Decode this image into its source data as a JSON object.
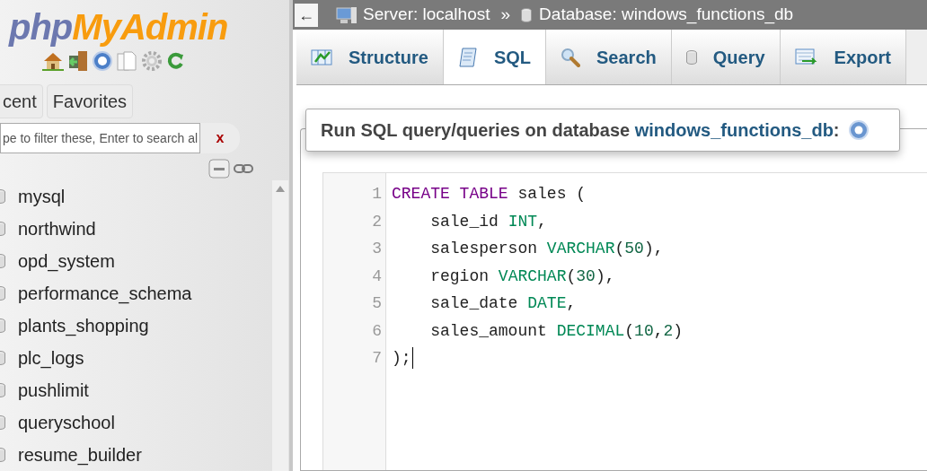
{
  "logo": {
    "part1": "php",
    "part2": "MyAdmin"
  },
  "nav_tabs": [
    {
      "label": "cent"
    },
    {
      "label": "Favorites"
    }
  ],
  "filter": {
    "placeholder": "pe to filter these, Enter to search al",
    "clear": "x"
  },
  "databases": [
    "mysql",
    "northwind",
    "opd_system",
    "performance_schema",
    "plants_shopping",
    "plc_logs",
    "pushlimit",
    "queryschool",
    "resume_builder"
  ],
  "breadcrumb": {
    "back": "←",
    "server": "Server: localhost",
    "separator": "»",
    "database": "Database: windows_functions_db"
  },
  "tabs": [
    {
      "label": "Structure",
      "kind": "structure",
      "selected": false
    },
    {
      "label": "SQL",
      "kind": "sql",
      "selected": true
    },
    {
      "label": "Search",
      "kind": "search",
      "selected": false
    },
    {
      "label": "Query",
      "kind": "query",
      "selected": false
    },
    {
      "label": "Export",
      "kind": "export",
      "selected": false
    }
  ],
  "heading": {
    "prefix": "Run SQL query/queries on database",
    "link": "windows_functions_db",
    "suffix": ":"
  },
  "editor": {
    "lines": [
      {
        "number": "1",
        "tokens": [
          {
            "kind": "keyword",
            "text": "CREATE TABLE"
          },
          {
            "kind": "plain",
            "text": " sales ("
          }
        ]
      },
      {
        "number": "2",
        "tokens": [
          {
            "kind": "plain",
            "text": "    sale_id "
          },
          {
            "kind": "type",
            "text": "INT"
          },
          {
            "kind": "plain",
            "text": ","
          }
        ]
      },
      {
        "number": "3",
        "tokens": [
          {
            "kind": "plain",
            "text": "    salesperson "
          },
          {
            "kind": "type",
            "text": "VARCHAR"
          },
          {
            "kind": "plain",
            "text": "("
          },
          {
            "kind": "number",
            "text": "50"
          },
          {
            "kind": "plain",
            "text": "),"
          }
        ]
      },
      {
        "number": "4",
        "tokens": [
          {
            "kind": "plain",
            "text": "    region "
          },
          {
            "kind": "type",
            "text": "VARCHAR"
          },
          {
            "kind": "plain",
            "text": "("
          },
          {
            "kind": "number",
            "text": "30"
          },
          {
            "kind": "plain",
            "text": "),"
          }
        ]
      },
      {
        "number": "5",
        "tokens": [
          {
            "kind": "plain",
            "text": "    sale_date "
          },
          {
            "kind": "type",
            "text": "DATE"
          },
          {
            "kind": "plain",
            "text": ","
          }
        ]
      },
      {
        "number": "6",
        "tokens": [
          {
            "kind": "plain",
            "text": "    sales_amount "
          },
          {
            "kind": "type",
            "text": "DECIMAL"
          },
          {
            "kind": "plain",
            "text": "("
          },
          {
            "kind": "number",
            "text": "10"
          },
          {
            "kind": "plain",
            "text": ","
          },
          {
            "kind": "number",
            "text": "2"
          },
          {
            "kind": "plain",
            "text": ")"
          }
        ]
      },
      {
        "number": "7",
        "tokens": [
          {
            "kind": "plain",
            "text": ");"
          }
        ],
        "cursor": true
      }
    ]
  }
}
